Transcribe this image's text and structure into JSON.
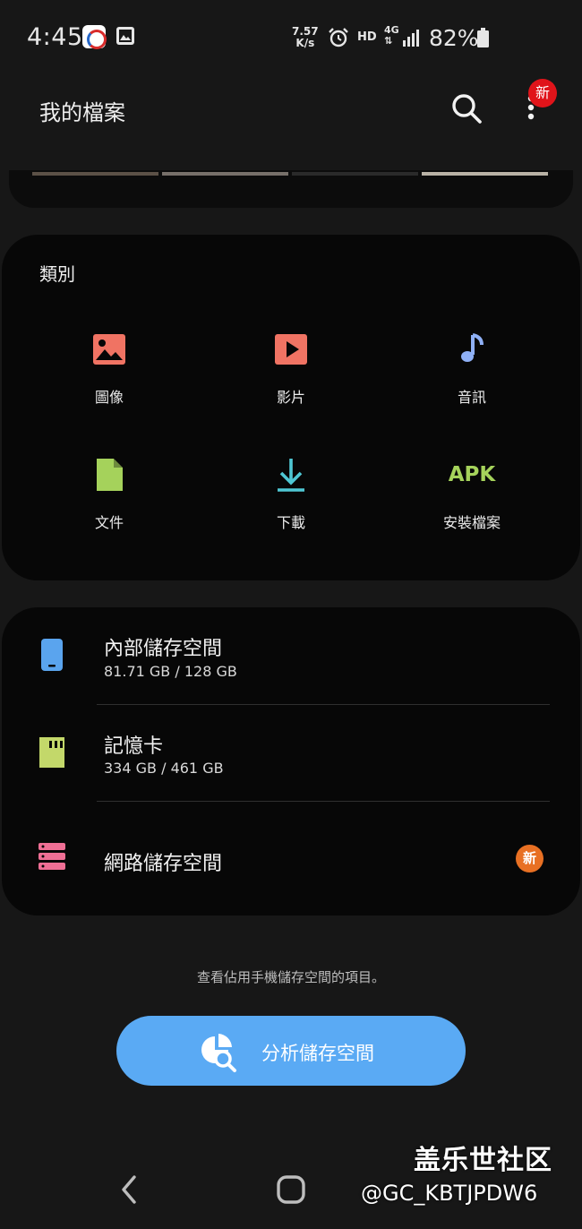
{
  "status_bar": {
    "time": "4:45",
    "net_speed_value": "7.57",
    "net_speed_unit": "K/s",
    "hd": "HD",
    "network": "4G",
    "battery": "82%"
  },
  "app_bar": {
    "title": "我的檔案",
    "new_label": "新",
    "search_icon": "search-icon",
    "more_icon": "more-vert-icon"
  },
  "categories": {
    "heading": "類別",
    "items": [
      {
        "label": "圖像",
        "icon": "image-icon",
        "color": "#f07363"
      },
      {
        "label": "影片",
        "icon": "video-icon",
        "color": "#f07363"
      },
      {
        "label": "音訊",
        "icon": "music-icon",
        "color": "#8fb0f5"
      },
      {
        "label": "文件",
        "icon": "document-icon",
        "color": "#a5d25b"
      },
      {
        "label": "下載",
        "icon": "download-icon",
        "color": "#4fc7d4"
      },
      {
        "label": "安裝檔案",
        "icon": "apk-icon",
        "icon_text": "APK",
        "color": "#a5d25b"
      }
    ]
  },
  "storage": {
    "items": [
      {
        "name": "內部儲存空間",
        "usage": "81.71 GB / 128 GB",
        "icon": "phone-icon",
        "color": "#5aa4ee"
      },
      {
        "name": "記憶卡",
        "usage": "334 GB / 461 GB",
        "icon": "sd-card-icon",
        "color": "#c3d86a"
      },
      {
        "name": "網路儲存空間",
        "icon": "network-storage-icon",
        "color": "#ef6f95",
        "badge": "新",
        "badge_color": "#e87023"
      }
    ]
  },
  "hint": "查看佔用手機儲存空間的項目。",
  "analyze_button": {
    "label": "分析儲存空間",
    "icon": "analyze-storage-icon",
    "color": "#5aaaf4"
  },
  "nav": {
    "back_icon": "back-icon",
    "home_icon": "home-icon"
  },
  "watermark": {
    "logo": "盖乐世社区",
    "user": "@GC_KBTJPDW6"
  }
}
